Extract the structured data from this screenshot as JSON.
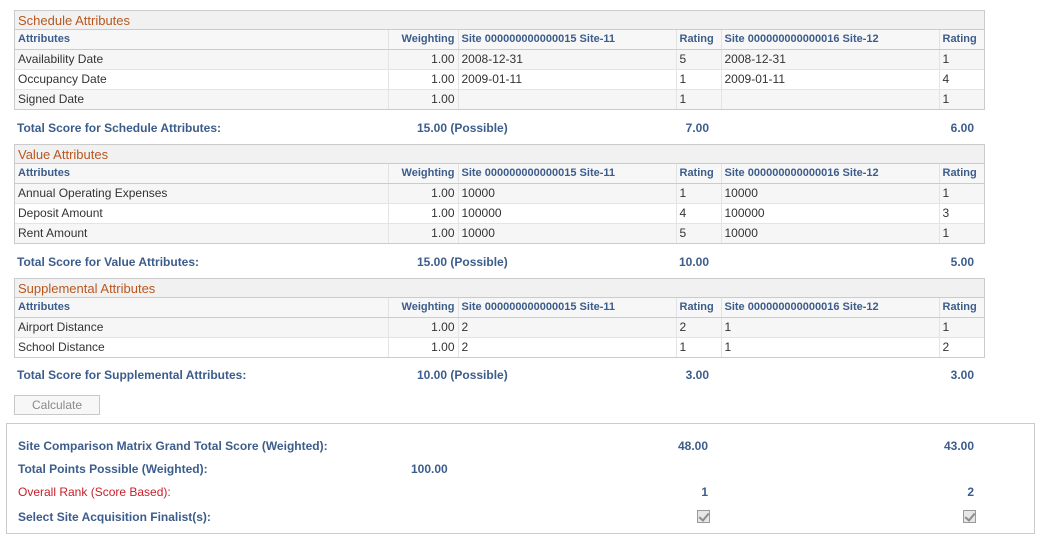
{
  "columns": {
    "attributes": "Attributes",
    "weighting": "Weighting",
    "site1": "Site 000000000000015 Site-11",
    "rating": "Rating",
    "site2": "Site 000000000000016 Site-12"
  },
  "schedule": {
    "title": "Schedule Attributes",
    "rows": [
      {
        "attr": "Availability Date",
        "weight": "1.00",
        "s1": "2008-12-31",
        "r1": "5",
        "s2": "2008-12-31",
        "r2": "1"
      },
      {
        "attr": "Occupancy Date",
        "weight": "1.00",
        "s1": "2009-01-11",
        "r1": "1",
        "s2": "2009-01-11",
        "r2": "4"
      },
      {
        "attr": "Signed Date",
        "weight": "1.00",
        "s1": "",
        "r1": "1",
        "s2": "",
        "r2": "1"
      }
    ],
    "total_label": "Total Score for Schedule Attributes:",
    "possible": "15.00 (Possible)",
    "total1": "7.00",
    "total2": "6.00"
  },
  "value": {
    "title": "Value Attributes",
    "rows": [
      {
        "attr": "Annual Operating Expenses",
        "weight": "1.00",
        "s1": "10000",
        "r1": "1",
        "s2": "10000",
        "r2": "1"
      },
      {
        "attr": "Deposit Amount",
        "weight": "1.00",
        "s1": "100000",
        "r1": "4",
        "s2": "100000",
        "r2": "3"
      },
      {
        "attr": "Rent Amount",
        "weight": "1.00",
        "s1": "10000",
        "r1": "5",
        "s2": "10000",
        "r2": "1"
      }
    ],
    "total_label": "Total Score for Value Attributes:",
    "possible": "15.00 (Possible)",
    "total1": "10.00",
    "total2": "5.00"
  },
  "supplemental": {
    "title": "Supplemental Attributes",
    "rows": [
      {
        "attr": "Airport Distance",
        "weight": "1.00",
        "s1": "2",
        "r1": "2",
        "s2": "1",
        "r2": "1"
      },
      {
        "attr": "School Distance",
        "weight": "1.00",
        "s1": "2",
        "r1": "1",
        "s2": "1",
        "r2": "2"
      }
    ],
    "total_label": "Total Score for Supplemental Attributes:",
    "possible": "10.00 (Possible)",
    "total1": "3.00",
    "total2": "3.00"
  },
  "calculate_label": "Calculate",
  "summary": {
    "grand_total_label": "Site Comparison Matrix Grand Total Score (Weighted):",
    "grand_total1": "48.00",
    "grand_total2": "43.00",
    "points_possible_label": "Total Points Possible (Weighted):",
    "points_possible": "100.00",
    "rank_label": "Overall Rank (Score Based):",
    "rank1": "1",
    "rank2": "2",
    "finalist_label": "Select Site Acquisition Finalist(s):",
    "finalist1_checked": true,
    "finalist2_checked": true
  }
}
